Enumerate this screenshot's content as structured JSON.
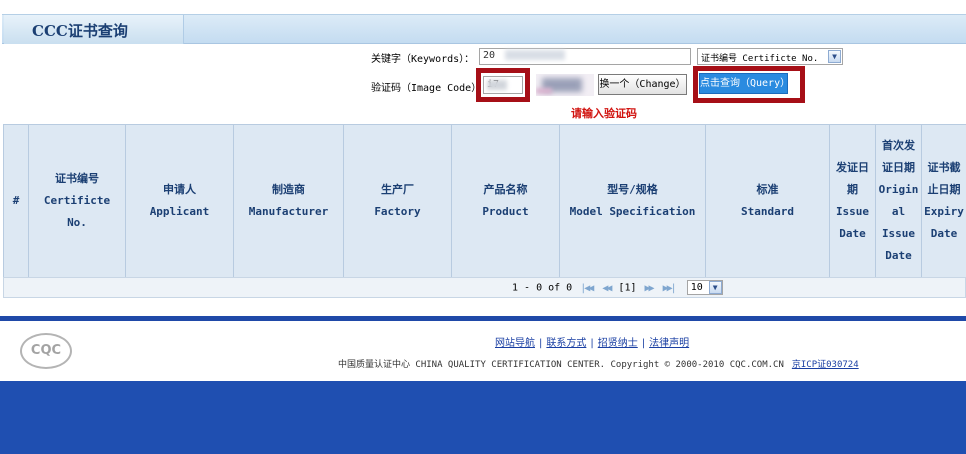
{
  "header": {
    "title": "CCC证书查询"
  },
  "form": {
    "keywords_label": "关键字（Keywords）：",
    "keywords_value": "20",
    "type_select_value": "证书编号 Certificte No.",
    "image_code_label": "验证码（Image Code）：",
    "image_code_value": "i7",
    "change_button": "换一个（Change）",
    "query_button": "点击查询（Query）",
    "warning": "请输入验证码"
  },
  "table": {
    "columns": [
      [
        "#"
      ],
      [
        "证书编号",
        "Certificte",
        "No."
      ],
      [
        "申请人",
        "Applicant"
      ],
      [
        "制造商",
        "Manufacturer"
      ],
      [
        "生产厂",
        "Factory"
      ],
      [
        "产品名称",
        "Product"
      ],
      [
        "型号/规格",
        "Model Specification"
      ],
      [
        "标准",
        "Standard"
      ],
      [
        "发证日",
        "期",
        "Issue",
        "Date"
      ],
      [
        "首次发",
        "证日期",
        "Origin",
        "al",
        "Issue",
        "Date"
      ],
      [
        "证书截",
        "止日期",
        "Expiry",
        "Date"
      ]
    ]
  },
  "pager": {
    "summary": "1 - 0 of 0",
    "first_icon": "first-page-icon",
    "prev_icon": "prev-page-icon",
    "pages": "[1]",
    "next_icon": "next-page-icon",
    "last_icon": "last-page-icon",
    "page_size": "10"
  },
  "footer": {
    "logo_text": "CQC",
    "links": [
      "网站导航",
      "联系方式",
      "招贤纳士",
      "法律声明"
    ],
    "copyright": "中国质量认证中心 CHINA QUALITY CERTIFICATION CENTER. Copyright © 2000-2010 CQC.COM.CN",
    "icp": "京ICP证030724"
  },
  "colors": {
    "brand_blue": "#1f4fb1",
    "highlight_red": "#a60f17",
    "query_button": "#2a8be0"
  }
}
